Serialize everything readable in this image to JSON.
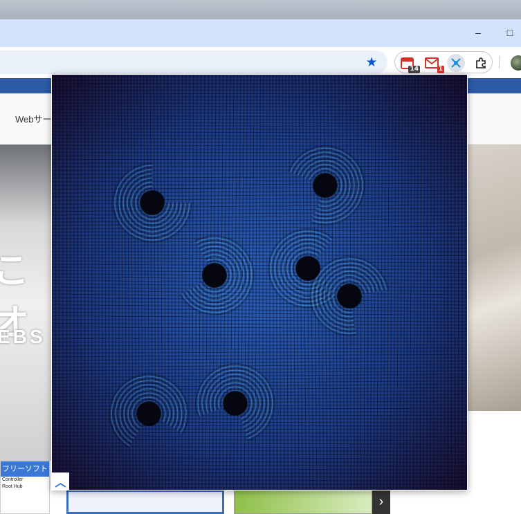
{
  "browser": {
    "window_controls": {
      "minimize": "–",
      "maximize": "□"
    },
    "extensions": [
      {
        "name": "calendar-extension",
        "badge": "14",
        "badge_color": "#444444"
      },
      {
        "name": "mail-extension",
        "badge": "1",
        "badge_color": "#d93025"
      },
      {
        "name": "fluid-extension",
        "badge": ""
      },
      {
        "name": "puzzle-extensions",
        "badge": ""
      }
    ]
  },
  "site": {
    "nav_label": "Webサー",
    "hero_text": "こオ",
    "hero_sub": "EBS",
    "card": {
      "title": "フリーソフト",
      "lines": [
        "Controller",
        "Root Hub"
      ]
    }
  },
  "popup": {
    "visual": "fluid-simulation-canvas",
    "colors": {
      "background": "#1a0f2e",
      "primary": "#2f6fd6",
      "highlight": "#68c8f0"
    }
  },
  "colors": {
    "accent": "#0b57d0",
    "site_bar": "#2d5ba7",
    "titlebar": "#d3e3fd"
  }
}
